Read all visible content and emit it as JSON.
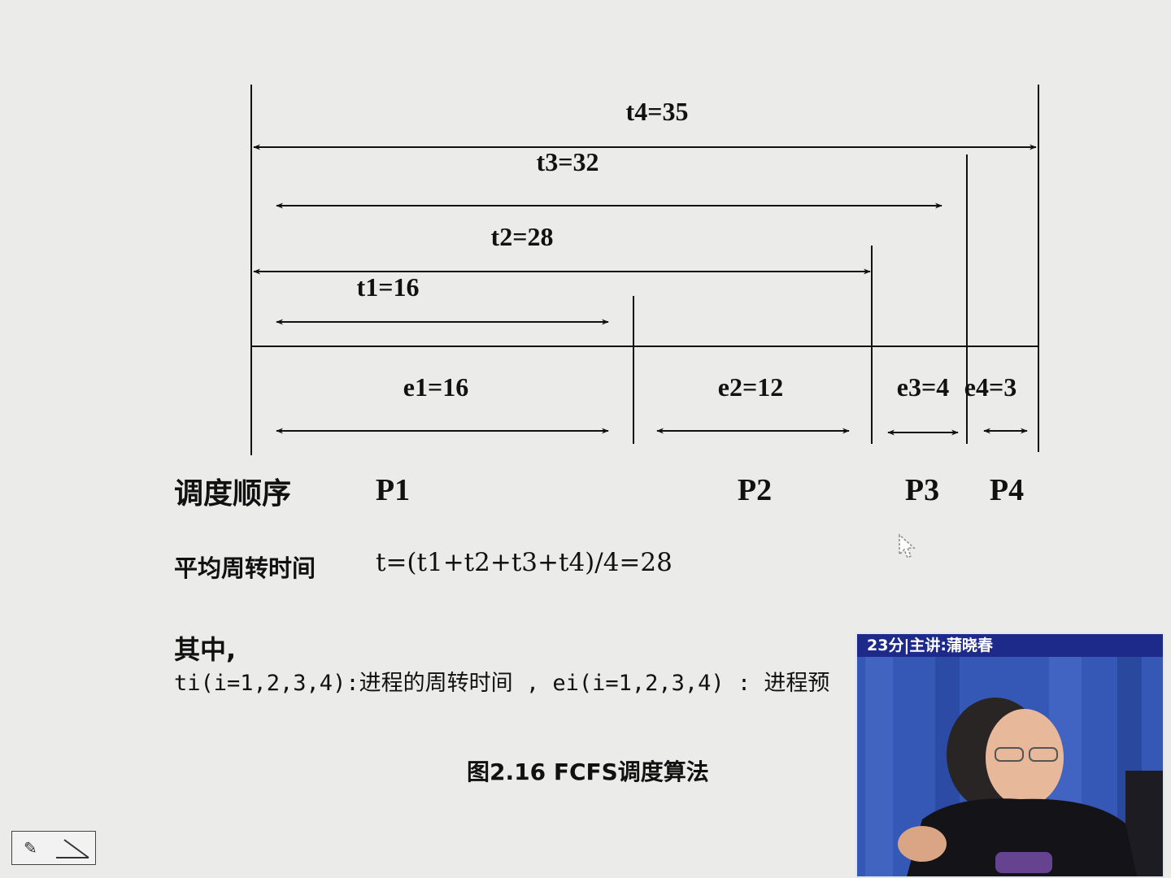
{
  "diagram": {
    "turnaround_labels": [
      "t4=35",
      "t3=32",
      "t2=28",
      "t1=16"
    ],
    "execution_labels": [
      "e1=16",
      "e2=12",
      "e3=4",
      "e4=3"
    ],
    "process_labels": [
      "P1",
      "P2",
      "P3",
      "P4"
    ]
  },
  "text": {
    "schedule_order_label": "调度顺序",
    "avg_turnaround_label": "平均周转时间",
    "avg_turnaround_formula": "t=(t1+t2+t3+t4)/4=28",
    "where_label": "其中,",
    "definition_line": "ti(i=1,2,3,4):进程的周转时间 , ei(i=1,2,3,4) : 进程预",
    "figure_caption": "图2.16  FCFS调度算法"
  },
  "video": {
    "caption": "23分|主讲:蒲晓春"
  },
  "colors": {
    "background": "#ebebea",
    "ink": "#111111",
    "video_caption_bar": "#1d2a8a",
    "video_backdrop": "#2f4fa8"
  },
  "icons": {
    "nav_pen": "pen-icon",
    "nav_arrow": "arrow-icon",
    "cursor": "pointer-icon"
  }
}
